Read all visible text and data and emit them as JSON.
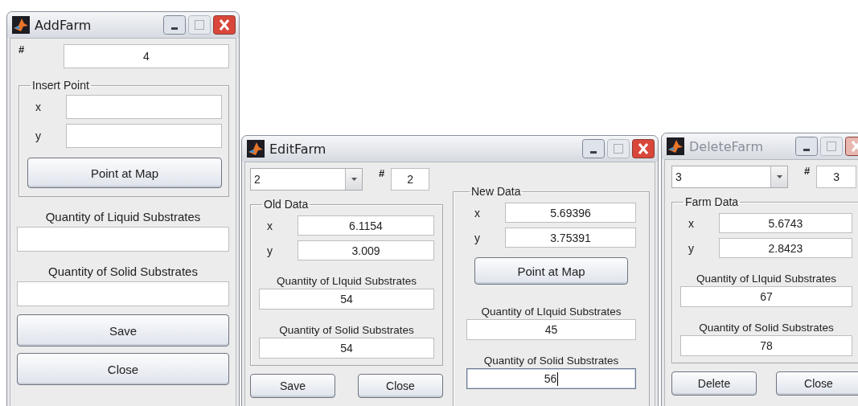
{
  "windows": [
    {
      "kind": "add",
      "title": "AddFarm",
      "active": true,
      "number": {
        "label": "#",
        "value": "4"
      },
      "groups": [
        {
          "title": "Insert Point",
          "items": [
            {
              "kind": "coord",
              "label": "x"
            },
            {
              "kind": "coord",
              "label": "y"
            },
            {
              "kind": "button",
              "label": "Point at Map"
            }
          ]
        }
      ],
      "items": [
        {
          "kind": "caption",
          "text": "Quantity of Liquid Substrates"
        },
        {
          "kind": "field",
          "focused": false
        },
        {
          "kind": "caption",
          "text": "Quantity of Solid Substrates"
        },
        {
          "kind": "field",
          "focused": false
        }
      ],
      "buttons": [
        {
          "label": "Save"
        },
        {
          "label": "Close"
        }
      ]
    },
    {
      "kind": "edit",
      "title": "EditFarm",
      "active": true,
      "selector": {
        "value": "2"
      },
      "number": {
        "label": "#",
        "value": "2"
      },
      "groups": [
        {
          "title": "Old Data",
          "items": [
            {
              "kind": "coord",
              "label": "x",
              "value": "6.1154"
            },
            {
              "kind": "coord",
              "label": "y",
              "value": "3.009"
            },
            {
              "kind": "caption",
              "text": "Quantity of LIquid Substrates"
            },
            {
              "kind": "field",
              "value": "54",
              "focused": false
            },
            {
              "kind": "caption",
              "text": "Quantity of Solid Substrates"
            },
            {
              "kind": "field",
              "value": "54",
              "focused": false
            }
          ]
        },
        {
          "title": "New Data",
          "items": [
            {
              "kind": "coord",
              "label": "x",
              "value": "5.69396"
            },
            {
              "kind": "coord",
              "label": "y",
              "value": "3.75391"
            },
            {
              "kind": "button",
              "label": "Point at Map"
            },
            {
              "kind": "caption",
              "text": "Quantity of LIquid Substrates"
            },
            {
              "kind": "field",
              "value": "45",
              "focused": false
            },
            {
              "kind": "caption",
              "text": "Quantity of Solid Substrates"
            },
            {
              "kind": "field",
              "value": "56",
              "focused": true
            }
          ]
        }
      ],
      "buttons": [
        {
          "label": "Save"
        },
        {
          "label": "Close"
        }
      ]
    },
    {
      "kind": "delete",
      "title": "DeleteFarm",
      "active": false,
      "selector": {
        "value": "3"
      },
      "number": {
        "label": "#",
        "value": "3"
      },
      "groups": [
        {
          "title": "Farm Data",
          "items": [
            {
              "kind": "coord",
              "label": "x",
              "value": "5.6743"
            },
            {
              "kind": "coord",
              "label": "y",
              "value": "2.8423"
            },
            {
              "kind": "caption",
              "text": "Quantity of LIquid Substrates"
            },
            {
              "kind": "field",
              "value": "67",
              "focused": false
            },
            {
              "kind": "caption",
              "text": "Quantity of Solid Substrates"
            },
            {
              "kind": "field",
              "value": "78",
              "focused": false
            }
          ]
        }
      ],
      "buttons": [
        {
          "label": "Delete"
        },
        {
          "label": "Close"
        }
      ]
    }
  ]
}
